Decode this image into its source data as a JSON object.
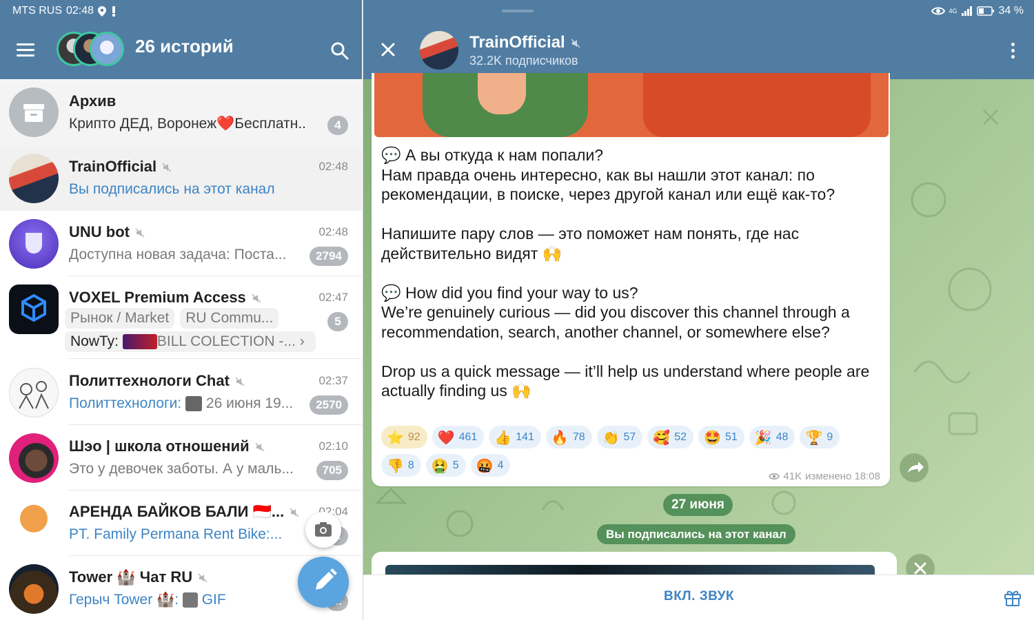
{
  "status_bar": {
    "carrier": "MTS RUS",
    "time": "02:48",
    "network": "4G",
    "battery": "34 %"
  },
  "chat_list": {
    "stories_title": "26 историй",
    "chats": [
      {
        "title": "Архив",
        "subtitle": "Крипто ДЕД, Воронеж❤️Бесплатн...",
        "badge": "4",
        "time": ""
      },
      {
        "title": "TrainOfficial",
        "subtitle": "Вы подписались на этот канал",
        "time": "02:48",
        "muted": true
      },
      {
        "title": "UNU bot",
        "subtitle": "Доступна новая задача:  Поста...",
        "time": "02:48",
        "badge": "2794",
        "muted": true
      },
      {
        "title": "VOXEL Premium Access",
        "time": "02:47",
        "badge": "5",
        "muted": true,
        "tags": [
          "Рынок / Market",
          "RU Commu..."
        ],
        "last_sender": "NowTy:",
        "last_text": "BILL COLECTION -..."
      },
      {
        "title": "Политтехнологи Chat",
        "sender": "Политтехнологи:",
        "subtitle": "26 июня 19...",
        "time": "02:37",
        "badge": "2570",
        "muted": true
      },
      {
        "title": "Шэо | школа отношений",
        "subtitle": "Это у девочек заботы. А у маль...",
        "time": "02:10",
        "badge": "705",
        "muted": true
      },
      {
        "title": "АРЕНДА БАЙКОВ БАЛИ 🇮🇩...",
        "subtitle": "PT. Family Permana Rent Bike:...",
        "time": "02:04",
        "badge": "2",
        "muted": true
      },
      {
        "title": "Tower 🏰 Чат RU",
        "sender": "Герыч Tower 🏰:",
        "subtitle": "GIF",
        "badge": "...",
        "muted": true
      }
    ]
  },
  "channel": {
    "title": "TrainOfficial",
    "subscribers": "32.2K подписчиков",
    "post": {
      "paragraphs": [
        "💬 А вы откуда к нам попали?\nНам правда очень интересно, как вы нашли этот канал: по рекомендации, в поиске, через другой канал или ещё как-то?",
        "Напишите пару слов — это поможет нам понять, где нас действительно видят 🙌",
        "💬 How did you find your way to us?\nWe’re genuinely curious — did you discover this channel through a recommendation, search, another channel, or somewhere else?",
        "Drop us a quick message — it’ll help us understand where people are actually finding us 🙌"
      ],
      "reactions": [
        {
          "emoji": "⭐",
          "count": "92",
          "mine": true
        },
        {
          "emoji": "❤️",
          "count": "461"
        },
        {
          "emoji": "👍",
          "count": "141"
        },
        {
          "emoji": "🔥",
          "count": "78"
        },
        {
          "emoji": "👏",
          "count": "57"
        },
        {
          "emoji": "🥰",
          "count": "52"
        },
        {
          "emoji": "🤩",
          "count": "51"
        },
        {
          "emoji": "🎉",
          "count": "48"
        },
        {
          "emoji": "🏆",
          "count": "9"
        },
        {
          "emoji": "👎",
          "count": "8"
        },
        {
          "emoji": "🤮",
          "count": "5"
        },
        {
          "emoji": "🤬",
          "count": "4"
        }
      ],
      "views": "41K",
      "edited": "изменено 18:08"
    },
    "date_label": "27 июня",
    "service_message": "Вы подписались на этот канал",
    "unmute_label": "ВКЛ. ЗВУК"
  },
  "colors": {
    "header": "#517da2",
    "accent": "#3d84c4",
    "fab": "#5aa4df",
    "story_ring": "#3fc7a0",
    "chat_bg": "#a5c795"
  }
}
